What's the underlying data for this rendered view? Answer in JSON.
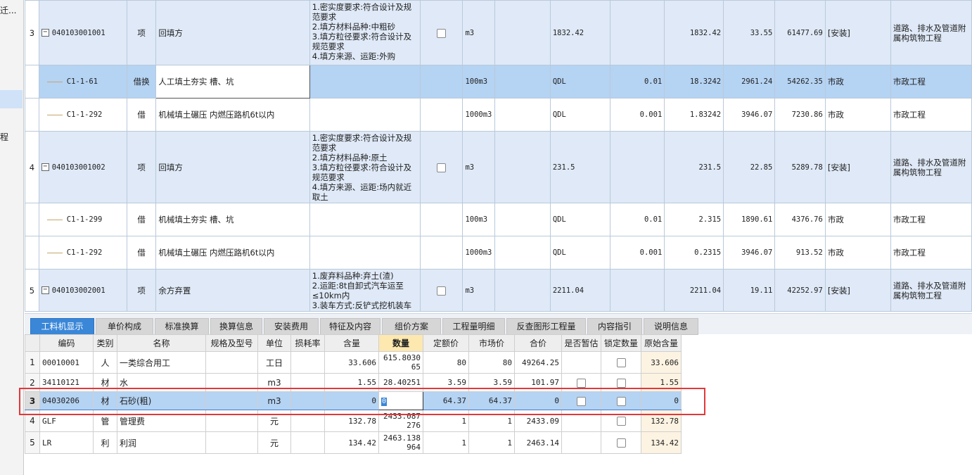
{
  "sidebar": {
    "labels": [
      "迁...",
      "程"
    ]
  },
  "upper_rows": [
    {
      "kind": "item",
      "no": "3",
      "code": "040103001001",
      "type": "项",
      "name": "回填方",
      "feature": "1.密实度要求:符合设计及规范要求\n2.填方材料品种:中粗砂\n3.填方粒径要求:符合设计及规范要求\n4.填方来源、运距:外购",
      "unit": "m3",
      "qty_expr": "1832.42",
      "content": "",
      "qty": "1832.42",
      "price": "33.55",
      "total": "61477.69",
      "major": "[安装]",
      "discipline": "道路、排水及管道附属构筑物工程"
    },
    {
      "kind": "sub",
      "selected": true,
      "code": "C1-1-61",
      "type": "借换",
      "name": "人工填土夯实 槽、坑",
      "unit": "100m3",
      "qty_expr": "QDL",
      "content": "0.01",
      "qty": "18.3242",
      "price": "2961.24",
      "total": "54262.35",
      "major": "市政",
      "discipline": "市政工程"
    },
    {
      "kind": "sub",
      "code": "C1-1-292",
      "type": "借",
      "name": "机械填土碾压 内燃压路机6t以内",
      "unit": "1000m3",
      "qty_expr": "QDL",
      "content": "0.001",
      "qty": "1.83242",
      "price": "3946.07",
      "total": "7230.86",
      "major": "市政",
      "discipline": "市政工程"
    },
    {
      "kind": "item",
      "no": "4",
      "code": "040103001002",
      "type": "项",
      "name": "回填方",
      "feature": "1.密实度要求:符合设计及规范要求\n2.填方材料品种:原土\n3.填方粒径要求:符合设计及规范要求\n4.填方来源、运距:场内就近取土",
      "unit": "m3",
      "qty_expr": "231.5",
      "content": "",
      "qty": "231.5",
      "price": "22.85",
      "total": "5289.78",
      "major": "[安装]",
      "discipline": "道路、排水及管道附属构筑物工程"
    },
    {
      "kind": "sub",
      "code": "C1-1-299",
      "type": "借",
      "name": "机械填土夯实 槽、坑",
      "unit": "100m3",
      "qty_expr": "QDL",
      "content": "0.01",
      "qty": "2.315",
      "price": "1890.61",
      "total": "4376.76",
      "major": "市政",
      "discipline": "市政工程"
    },
    {
      "kind": "sub",
      "code": "C1-1-292",
      "type": "借",
      "name": "机械填土碾压 内燃压路机6t以内",
      "unit": "1000m3",
      "qty_expr": "QDL",
      "content": "0.001",
      "qty": "0.2315",
      "price": "3946.07",
      "total": "913.52",
      "major": "市政",
      "discipline": "市政工程"
    },
    {
      "kind": "item",
      "no": "5",
      "code": "040103002001",
      "type": "项",
      "name": "余方弃置",
      "feature": "1.废弃料品种:弃土(渣)\n2.运距:8t自卸式汽车运至≤10km内\n3.装车方式:反铲式挖机装车",
      "unit": "m3",
      "qty_expr": "2211.04",
      "content": "",
      "qty": "2211.04",
      "price": "19.11",
      "total": "42252.97",
      "major": "[安装]",
      "discipline": "道路、排水及管道附属构筑物工程"
    }
  ],
  "tabs": [
    "工料机显示",
    "单价构成",
    "标准换算",
    "换算信息",
    "安装费用",
    "特征及内容",
    "组价方案",
    "工程量明细",
    "反查图形工程量",
    "内容指引",
    "说明信息"
  ],
  "lower_headers": [
    "",
    "编码",
    "类别",
    "名称",
    "规格及型号",
    "单位",
    "损耗率",
    "含量",
    "数量",
    "定额价",
    "市场价",
    "合价",
    "是否暂估",
    "锁定数量",
    "原始含量"
  ],
  "lower_rows": [
    {
      "no": "1",
      "code": "00010001",
      "cat": "人",
      "name": "一类综合用工",
      "spec": "",
      "unit": "工日",
      "loss": "",
      "content": "33.606",
      "qty": "615.803065",
      "base_price": "80",
      "market_price": "80",
      "total": "49264.25",
      "provisional": "",
      "locked": false,
      "orig": "33.606"
    },
    {
      "no": "2",
      "code": "34110121",
      "cat": "材",
      "name": "水",
      "spec": "",
      "unit": "m3",
      "loss": "",
      "content": "1.55",
      "qty": "28.40251",
      "base_price": "3.59",
      "market_price": "3.59",
      "total": "101.97",
      "provisional": false,
      "locked": false,
      "orig": "1.55"
    },
    {
      "no": "3",
      "code": "04030206",
      "cat": "材",
      "name": "石砂(粗)",
      "spec": "",
      "unit": "m3",
      "loss": "",
      "content": "0",
      "qty": "0",
      "base_price": "64.37",
      "market_price": "64.37",
      "total": "0",
      "provisional": false,
      "locked": false,
      "orig": "0",
      "selected": true
    },
    {
      "no": "4",
      "code": "GLF",
      "cat": "管",
      "name": "管理费",
      "spec": "",
      "unit": "元",
      "loss": "",
      "content": "132.78",
      "qty": "2433.087276",
      "base_price": "1",
      "market_price": "1",
      "total": "2433.09",
      "provisional": "",
      "locked": false,
      "orig": "132.78"
    },
    {
      "no": "5",
      "code": "LR",
      "cat": "利",
      "name": "利润",
      "spec": "",
      "unit": "元",
      "loss": "",
      "content": "134.42",
      "qty": "2463.138964",
      "base_price": "1",
      "market_price": "1",
      "total": "2463.14",
      "provisional": "",
      "locked": false,
      "orig": "134.42"
    }
  ],
  "colors": {
    "accent": "#3a87d8",
    "selected_row": "#b5d3f3",
    "item_row": "#dfe9f7",
    "annotation": "#e0383b"
  }
}
